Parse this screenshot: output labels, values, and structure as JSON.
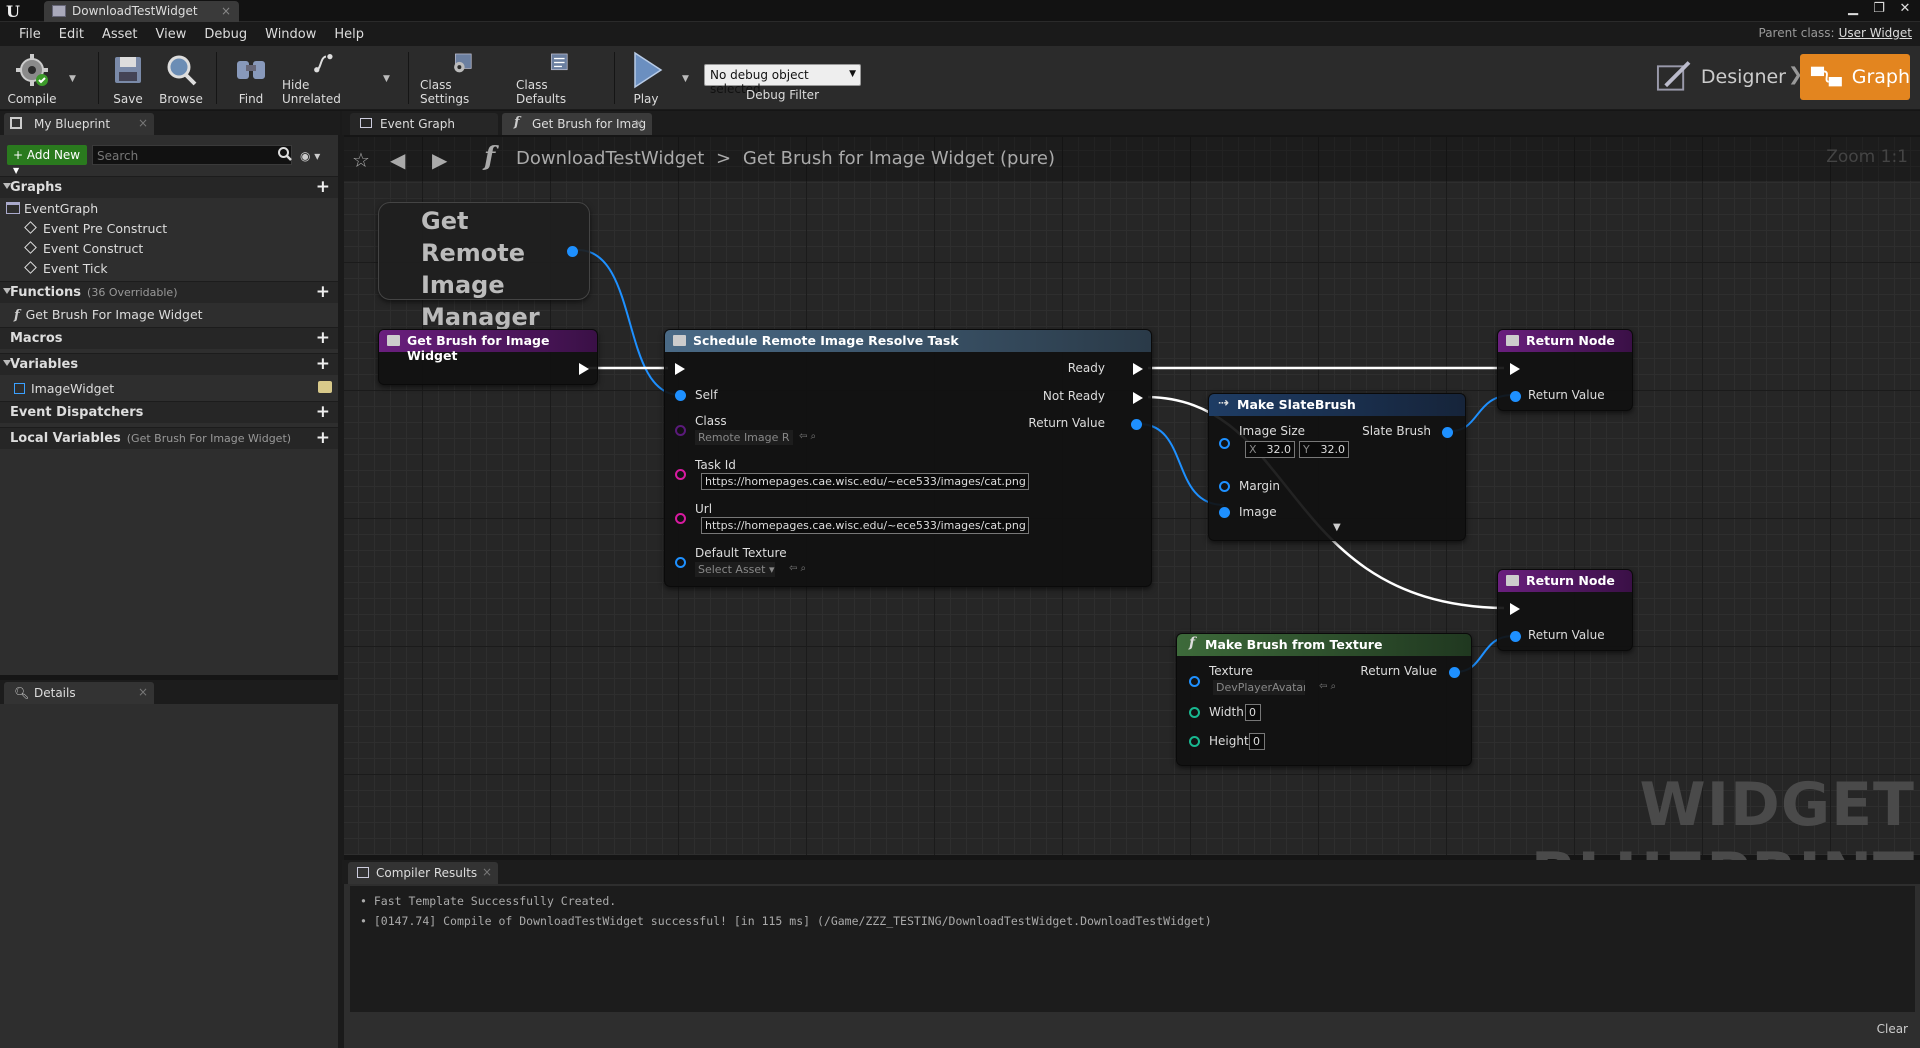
{
  "window": {
    "tab_title": "DownloadTestWidget",
    "parent_class_label": "Parent class:",
    "parent_class_value": "User Widget"
  },
  "menu": [
    "File",
    "Edit",
    "Asset",
    "View",
    "Debug",
    "Window",
    "Help"
  ],
  "toolbar": {
    "compile": "Compile",
    "save": "Save",
    "browse": "Browse",
    "find": "Find",
    "hide_unrelated": "Hide Unrelated",
    "class_settings": "Class Settings",
    "class_defaults": "Class Defaults",
    "play": "Play",
    "debug_select": "No debug object selected",
    "debug_filter": "Debug Filter",
    "designer": "Designer",
    "graph": "Graph"
  },
  "my_blueprint": {
    "tab": "My Blueprint",
    "add_new": "Add New",
    "search_placeholder": "Search",
    "graphs_header": "Graphs",
    "event_graph": "EventGraph",
    "events": [
      "Event Pre Construct",
      "Event Construct",
      "Event Tick"
    ],
    "functions_header": "Functions",
    "functions_count": "(36 Overridable)",
    "function_item": "Get Brush For Image Widget",
    "macros_header": "Macros",
    "variables_header": "Variables",
    "variable_item": "ImageWidget",
    "dispatchers_header": "Event Dispatchers",
    "locals_header": "Local Variables",
    "locals_context": "(Get Brush For Image Widget)"
  },
  "details": {
    "tab": "Details"
  },
  "graph": {
    "tabs": [
      "Event Graph",
      "Get Brush for Imag"
    ],
    "breadcrumb_root": "DownloadTestWidget",
    "breadcrumb_sep": ">",
    "breadcrumb_leaf": "Get Brush for Image Widget (pure)",
    "zoom": "Zoom 1:1",
    "watermark": "WIDGET BLUEPRINT"
  },
  "nodes": {
    "remote_manager": "Get Remote Image Manager",
    "entry": "Get Brush for Image Widget",
    "schedule": {
      "title": "Schedule Remote Image Resolve Task",
      "self": "Self",
      "class": "Class",
      "class_value": "Remote Image R",
      "task_id": "Task Id",
      "task_id_value": "https://homepages.cae.wisc.edu/~ece533/images/cat.png",
      "url": "Url",
      "url_value": "https://homepages.cae.wisc.edu/~ece533/images/cat.png",
      "default_texture": "Default Texture",
      "default_texture_value": "Select Asset",
      "ready": "Ready",
      "not_ready": "Not Ready",
      "return_value": "Return Value"
    },
    "make_slate": {
      "title": "Make SlateBrush",
      "image_size": "Image Size",
      "x_label": "X",
      "x_value": "32.0",
      "y_label": "Y",
      "y_value": "32.0",
      "margin": "Margin",
      "image": "Image",
      "slate_brush": "Slate Brush"
    },
    "return1": {
      "title": "Return Node",
      "return_value": "Return Value"
    },
    "return2": {
      "title": "Return Node",
      "return_value": "Return Value"
    },
    "make_brush": {
      "title": "Make Brush from Texture",
      "texture": "Texture",
      "texture_value": "DevPlayerAvatar",
      "width": "Width",
      "width_value": "0",
      "height": "Height",
      "height_value": "0",
      "return_value": "Return Value"
    }
  },
  "compiler": {
    "tab": "Compiler Results",
    "lines": [
      "Fast Template Successfully Created.",
      "[0147.74] Compile of DownloadTestWidget successful! [in 115 ms] (/Game/ZZZ_TESTING/DownloadTestWidget.DownloadTestWidget)"
    ],
    "clear": "Clear"
  },
  "colors": {
    "accent_orange": "#e3851f",
    "add_new_green": "#2a7a1e",
    "pin_blue": "#1e90ff",
    "function_header": "#5c1a6e",
    "call_header": "#4a6a86",
    "struct_header": "#1e3c64",
    "pure_header": "#3d6a3a"
  }
}
